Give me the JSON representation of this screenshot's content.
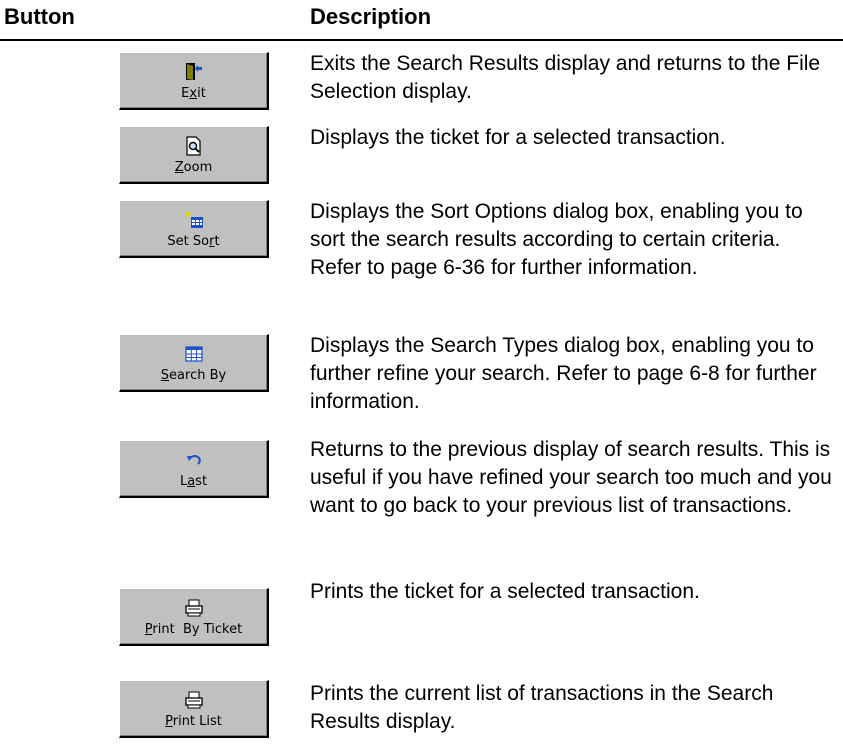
{
  "header": {
    "button_col": "Button",
    "description_col": "Description"
  },
  "rows": [
    {
      "label": "Exit",
      "mnemonic_index": 1,
      "icon": "exit-door-icon",
      "description": "Exits the Search Results display and returns to the File Selection display."
    },
    {
      "label": "Zoom",
      "mnemonic_index": 0,
      "icon": "zoom-page-icon",
      "description": "Displays the ticket for a selected transaction."
    },
    {
      "label": "Set Sort",
      "mnemonic_index": 6,
      "icon": "set-sort-icon",
      "description": "Displays the Sort Options dialog box, enabling you to sort the search results according to certain criteria. Refer to page 6-36 for further information."
    },
    {
      "label": "Search By",
      "mnemonic_index": 0,
      "icon": "search-by-grid-icon",
      "description": "Displays the Search Types dialog box, enabling you to further refine your search. Refer to page 6-8 for further information."
    },
    {
      "label": "Last",
      "mnemonic_index": 1,
      "icon": "undo-arrow-icon",
      "description": "Returns to the previous display of search results. This is useful if you have refined your search too much and you want to go back to your previous list of transactions."
    },
    {
      "label": "Print  By Ticket",
      "mnemonic_index": 0,
      "icon": "printer-icon",
      "description": "Prints the ticket for a selected transaction."
    },
    {
      "label": "Print List",
      "mnemonic_index": 0,
      "icon": "printer-icon",
      "description": "Prints the current list of transactions in the Search Results display."
    }
  ],
  "colors": {
    "button_face": "#c0c0c0",
    "icon_blue": "#1e50c8",
    "icon_olive": "#808000"
  }
}
